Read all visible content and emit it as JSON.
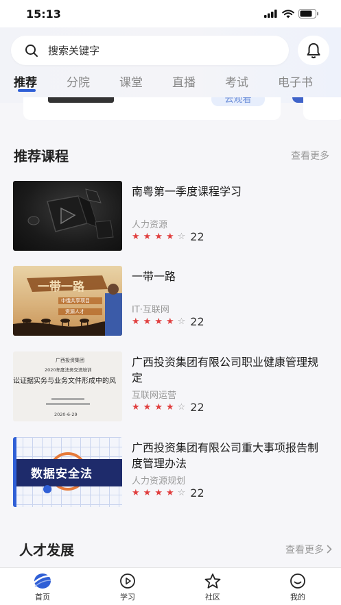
{
  "status_bar": {
    "time": "15:13"
  },
  "search": {
    "placeholder": "搜索关键字"
  },
  "tabs": [
    {
      "label": "推荐",
      "active": true
    },
    {
      "label": "分院"
    },
    {
      "label": "课堂"
    },
    {
      "label": "直播"
    },
    {
      "label": "考试"
    },
    {
      "label": "电子书"
    }
  ],
  "banner": {
    "button_label": "云观看"
  },
  "recommended": {
    "title": "推荐课程",
    "more": "查看更多",
    "courses": [
      {
        "title": "南粤第一季度课程学习",
        "category": "人力资源",
        "rating": 4,
        "count": "22"
      },
      {
        "title": "一带一路",
        "category": "IT·互联网",
        "rating": 4,
        "count": "22",
        "thumb_text": {
          "banner": "一带一路",
          "line1": "中俄共享项目",
          "line2": "资源人才"
        }
      },
      {
        "title": "广西投资集团有限公司职业健康管理规定",
        "category": "互联网运营",
        "rating": 4,
        "count": "22",
        "thumb_text": {
          "org": "广西投资集团",
          "sub": "2020年度法务交流培训",
          "main": "讼证据实务与业务文件形成中的风",
          "date": "2020-6-29"
        }
      },
      {
        "title": "广西投资集团有限公司重大事项报告制度管理办法",
        "category": "人力资源规划",
        "rating": 4,
        "count": "22",
        "thumb_text": {
          "main": "数据安全法"
        }
      }
    ]
  },
  "talent": {
    "title": "人才发展",
    "more": "查看更多"
  },
  "tabbar": [
    {
      "label": "首页",
      "icon": "home-logo-icon",
      "active": true
    },
    {
      "label": "学习",
      "icon": "play-circle-icon"
    },
    {
      "label": "社区",
      "icon": "star-icon"
    },
    {
      "label": "我的",
      "icon": "smile-face-icon"
    }
  ],
  "colors": {
    "accent": "#2f5fd6",
    "star": "#e03e3e"
  }
}
